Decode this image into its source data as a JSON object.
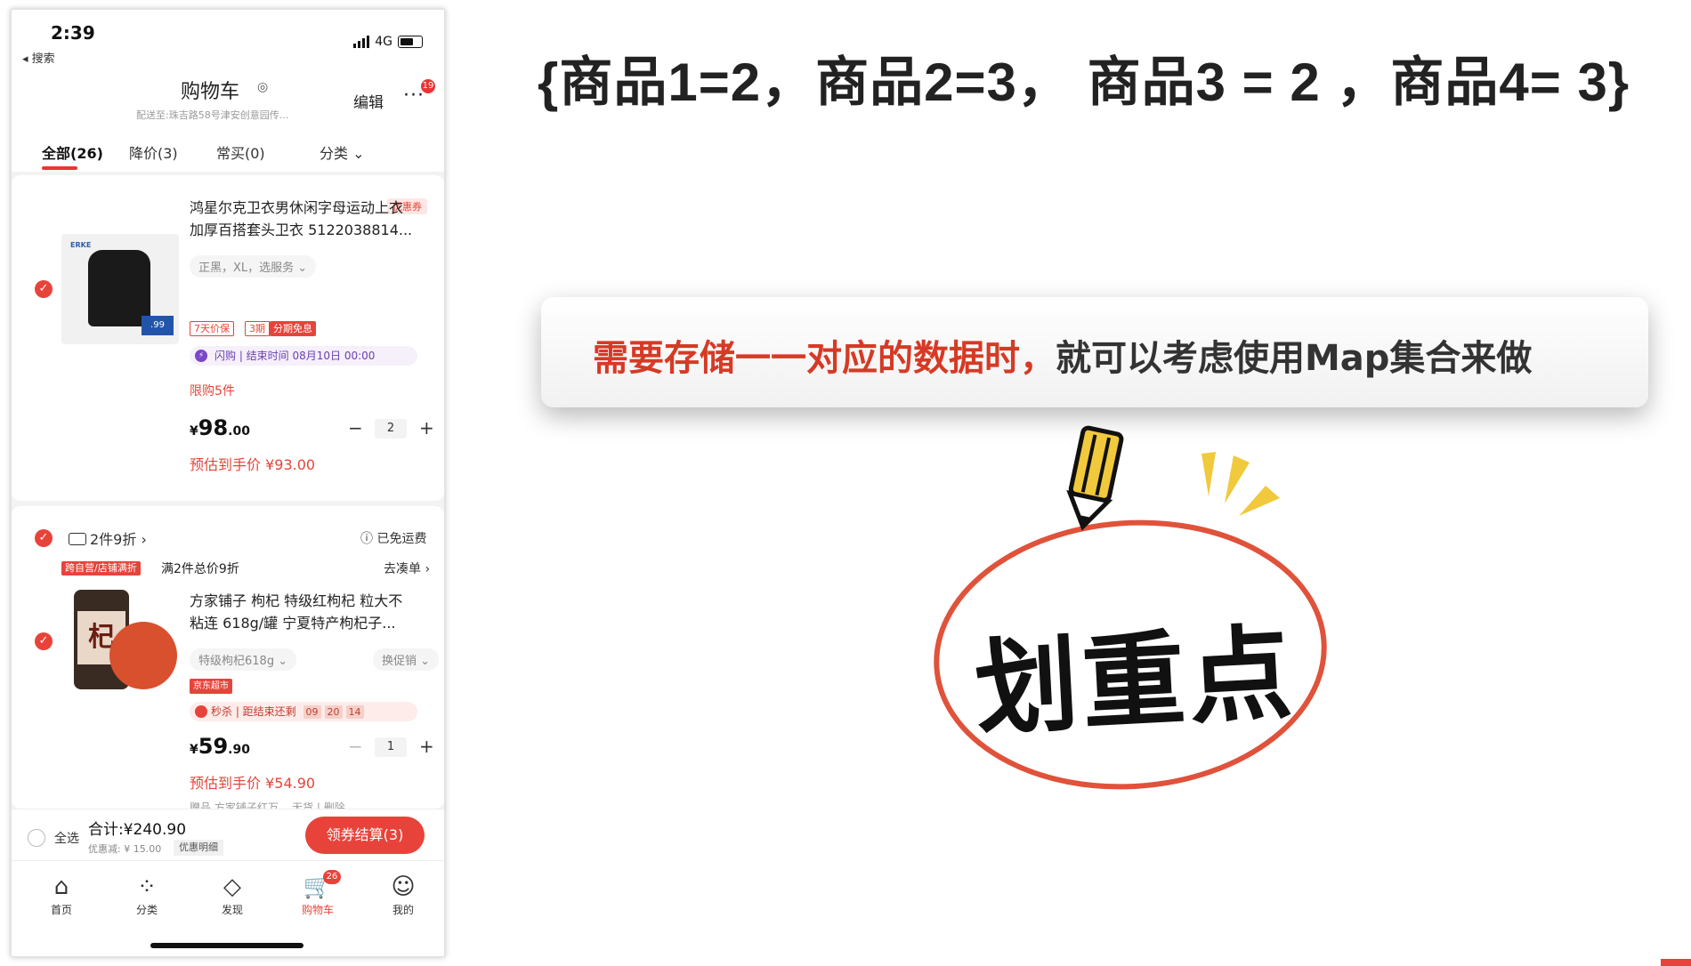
{
  "phone": {
    "status": {
      "time": "2:39",
      "back": "◂ 搜索",
      "network": "4G"
    },
    "header": {
      "title": "购物车",
      "address": "配送至:珠吉路58号津安创意园传...",
      "edit": "编辑",
      "more_badge": "19"
    },
    "tabs": [
      "全部(26)",
      "降价(3)",
      "常买(0)",
      "分类 ⌄"
    ],
    "item1": {
      "coupon": "优惠券",
      "brand_logo": "ERKE",
      "tag_price": ".99",
      "title_line1": "鸿星尔克卫衣男休闲字母运动上衣",
      "title_line2": "加厚百搭套头卫衣 5122038814...",
      "sku": "正黑，XL，选服务 ⌄",
      "tag1": "7天价保",
      "tag2a": "3期",
      "tag2b": "分期免息",
      "flash": "闪购 | 结束时间 08月10日 00:00",
      "limit": "限购5件",
      "price_symbol": "¥",
      "price_int": "98",
      "price_dec": ".00",
      "qty": "2",
      "estimate": "预估到手价 ¥93.00"
    },
    "item2_group": {
      "promo": "2件9折 ›",
      "freeship": "ⓘ 已免运费",
      "shop_tag": "跨自营/店铺满折",
      "promo_desc": "满2件总价9折",
      "goto": "去凑单 ›"
    },
    "item2": {
      "jar_char": "杞",
      "title_line1": "方家铺子 枸杞 特级红枸杞 粒大不",
      "title_line2": "粘连 618g/罐 宁夏特产枸杞子...",
      "sku": "特级枸杞618g ⌄",
      "change_promo": "换促销 ⌄",
      "store_tag": "京东超市",
      "seckill": "秒杀 | 距结束还剩",
      "t1": "09",
      "t2": "20",
      "t3": "14",
      "price_symbol": "¥",
      "price_int": "59",
      "price_dec": ".90",
      "qty": "1",
      "estimate": "预估到手价 ¥54.90",
      "gift_row": "赠品  方家铺子红万... 无货 | 删除"
    },
    "bottom": {
      "select_all": "全选",
      "total": "合计:¥240.90",
      "discount": "优惠减: ¥ 15.00",
      "detail": "优惠明细",
      "checkout": "领券结算(3)"
    },
    "tabbar": [
      {
        "label": "首页",
        "icon": "home-icon"
      },
      {
        "label": "分类",
        "icon": "category-icon"
      },
      {
        "label": "发现",
        "icon": "discover-icon"
      },
      {
        "label": "购物车",
        "icon": "cart-icon",
        "badge": "26"
      },
      {
        "label": "我的",
        "icon": "profile-icon"
      }
    ]
  },
  "slide": {
    "map_example": "{商品1=2，商品2=3， 商品3 = 2 ，商品4= 3}",
    "note_highlight": "需要存储一一对应的数据时，",
    "note_rest": "就可以考虑使用Map集合来做",
    "key_point": "划重点"
  },
  "colors": {
    "accent": "#e8433a",
    "highlight_text": "#d63a25"
  }
}
